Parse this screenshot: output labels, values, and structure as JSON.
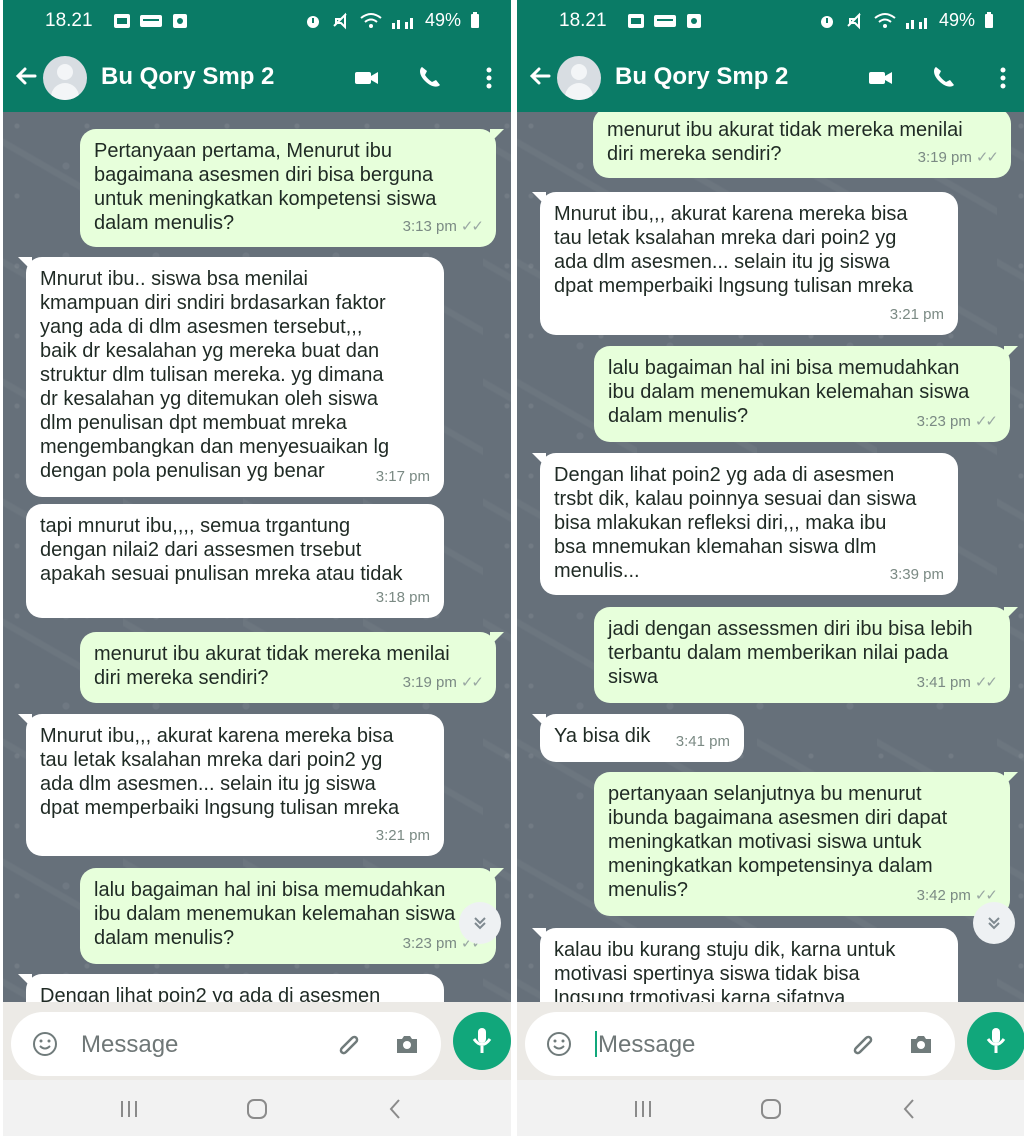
{
  "phones": [
    {
      "status_time": "18.21",
      "status_battery": "49%",
      "contact_name": "Bu Qory Smp 2",
      "message_placeholder": "Message",
      "messages": [
        {
          "side": "out",
          "text": "Pertanyaan pertama, Menurut ibu\nbagaimana asesmen diri bisa berguna\nuntuk meningkatkan kompetensi siswa\ndalam menulis?",
          "time": "3:13 pm"
        },
        {
          "side": "in",
          "text": "Mnurut ibu.. siswa bsa menilai\nkmampuan diri sndiri brdasarkan faktor\nyang ada di dlm asesmen tersebut,,,\nbaik dr kesalahan yg mereka buat dan\nstruktur dlm tulisan mereka. yg dimana\ndr kesalahan yg ditemukan oleh siswa\ndlm penulisan dpt membuat mreka\nmengembangkan dan menyesuaikan lg\ndengan pola penulisan yg benar",
          "time": "3:17 pm"
        },
        {
          "side": "in",
          "text": "tapi mnurut ibu,,,, semua trgantung\ndengan nilai2 dari assesmen trsebut\napakah sesuai pnulisan mreka atau tidak",
          "time": "3:18 pm"
        },
        {
          "side": "out",
          "text": "menurut ibu akurat tidak mereka menilai\ndiri mereka sendiri?",
          "time": "3:19 pm"
        },
        {
          "side": "in",
          "text": "Mnurut ibu,,, akurat karena mereka bisa\ntau letak ksalahan mreka dari poin2 yg\nada dlm asesmen... selain itu jg siswa\ndpat memperbaiki lngsung tulisan mreka",
          "time": "3:21 pm"
        },
        {
          "side": "out",
          "text": "lalu bagaiman hal ini bisa memudahkan\nibu dalam menemukan kelemahan siswa\ndalam menulis?",
          "time": "3:23 pm"
        },
        {
          "side": "in",
          "text": "Dengan lihat poin2 yg ada di asesmen",
          "time": ""
        }
      ]
    },
    {
      "status_time": "18.21",
      "status_battery": "49%",
      "contact_name": "Bu Qory Smp 2",
      "message_placeholder": "Message",
      "messages": [
        {
          "side": "out",
          "text": "menurut ibu akurat tidak mereka menilai\ndiri mereka sendiri?",
          "time": "3:19 pm"
        },
        {
          "side": "in",
          "text": "Mnurut ibu,,, akurat karena mereka bisa\ntau letak ksalahan mreka dari poin2 yg\nada dlm asesmen... selain itu jg siswa\ndpat memperbaiki lngsung tulisan mreka",
          "time": "3:21 pm"
        },
        {
          "side": "out",
          "text": "lalu bagaiman hal ini bisa memudahkan\nibu dalam menemukan kelemahan siswa\ndalam menulis?",
          "time": "3:23 pm"
        },
        {
          "side": "in",
          "text": "Dengan lihat poin2 yg ada di asesmen\ntrsbt dik, kalau poinnya sesuai dan siswa\nbisa mlakukan refleksi diri,,, maka ibu\nbsa mnemukan klemahan siswa dlm\nmenulis...",
          "time": "3:39 pm"
        },
        {
          "side": "out",
          "text": "jadi dengan assessmen diri ibu bisa lebih\nterbantu dalam memberikan nilai pada\nsiswa",
          "time": "3:41 pm"
        },
        {
          "side": "in",
          "text": "Ya bisa dik",
          "time": "3:41 pm"
        },
        {
          "side": "out",
          "text": "pertanyaan selanjutnya bu menurut\nibunda bagaimana asesmen diri dapat\nmeningkatkan motivasi siswa untuk\nmeningkatkan kompetensinya dalam\nmenulis?",
          "time": "3:42 pm"
        },
        {
          "side": "in",
          "text": "kalau ibu kurang stuju dik, karna untuk\nmotivasi spertinya siswa tidak bisa\nlngsung trmotivasi karna sifatnya",
          "time": ""
        }
      ]
    }
  ]
}
